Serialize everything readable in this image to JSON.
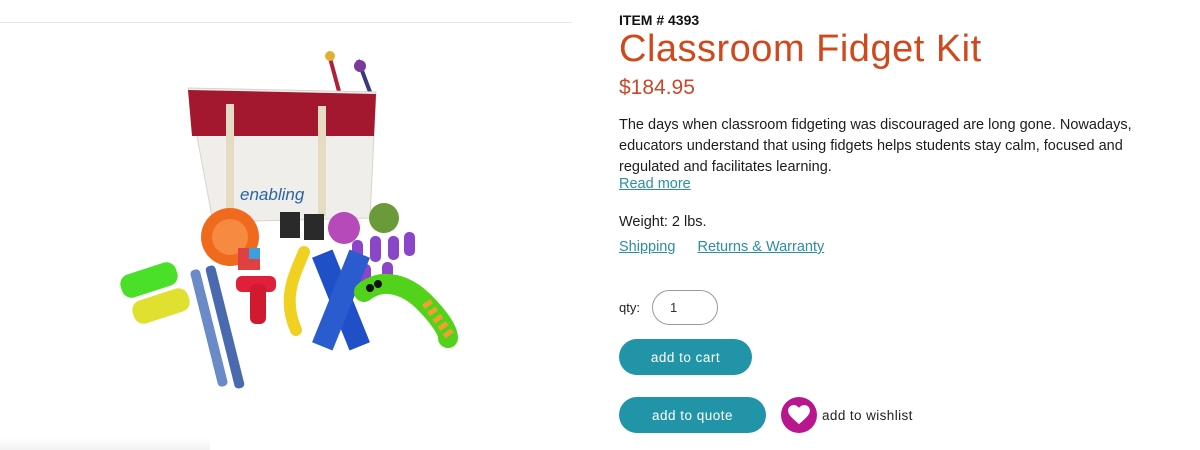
{
  "product": {
    "item_number": "ITEM # 4393",
    "title": "Classroom Fidget Kit",
    "price": "$184.95",
    "description": "The days when classroom fidgeting was discouraged are long gone. Nowadays, educators understand that using fidgets helps students stay calm, focused and regulated and facilitates learning.",
    "read_more": "Read more",
    "weight": "Weight: 2 lbs.",
    "image_brand": "enabling"
  },
  "links": {
    "shipping": "Shipping",
    "returns": "Returns & Warranty"
  },
  "purchase": {
    "qty_label": "qty:",
    "qty_value": "1",
    "add_to_cart": "add to cart",
    "add_to_quote": "add to quote",
    "add_to_wishlist": "add to wishlist"
  },
  "colors": {
    "title": "#d0481c",
    "price": "#c9472a",
    "link": "#2a8fa5",
    "button": "#2195a7",
    "wishlist_heart_bg": "#b7168e"
  },
  "icons": {
    "wishlist": "heart-icon"
  }
}
